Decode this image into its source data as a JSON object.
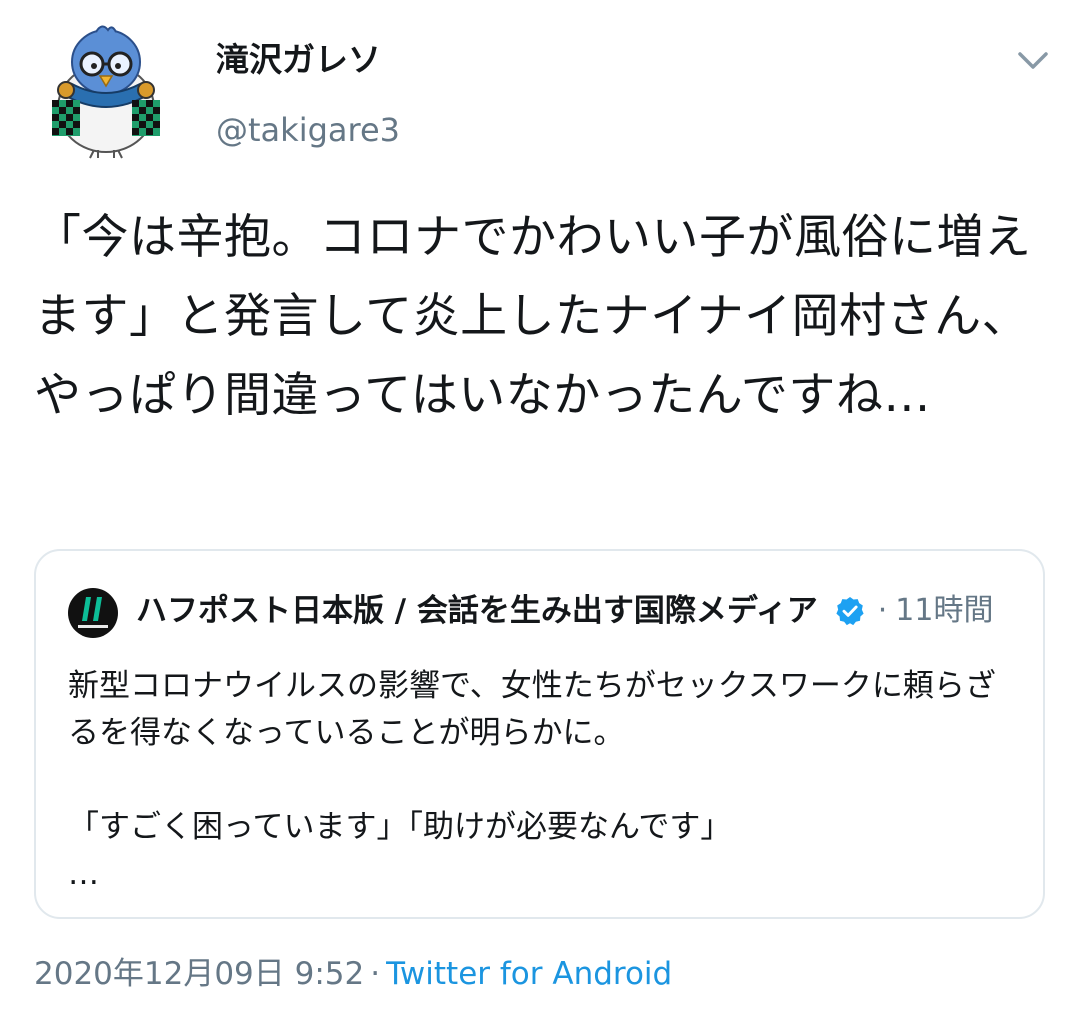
{
  "author": {
    "display_name": "滝沢ガレソ",
    "handle": "@takigare3",
    "avatar_icon": "bird-avatar-icon"
  },
  "tweet": {
    "text": "「今は辛抱。コロナでかわいい子が風俗に増えます」と発言して炎上したナイナイ岡村さん、やっぱり間違ってはいなかったんですね…"
  },
  "quote": {
    "name": "ハフポスト日本版 / 会話を生み出す国際メディア",
    "time": "11時間",
    "dot": "·",
    "body": "新型コロナウイルスの影響で、女性たちがセックスワークに頼らざるを得なくなっていることが明らかに。\n\n「すごく困っています」「助けが必要なんです」\n…",
    "avatar_icon": "huffpost-logo-icon",
    "verified_icon": "verified-badge-icon"
  },
  "meta": {
    "date": "2020年12月09日 9:52",
    "dot": "·",
    "source": "Twitter for Android"
  },
  "colors": {
    "text": "#14171a",
    "secondary": "#657786",
    "link": "#1b95e0",
    "verified": "#1da1f2",
    "border": "#e1e8ed",
    "huffpost_green": "#0dbe98"
  }
}
